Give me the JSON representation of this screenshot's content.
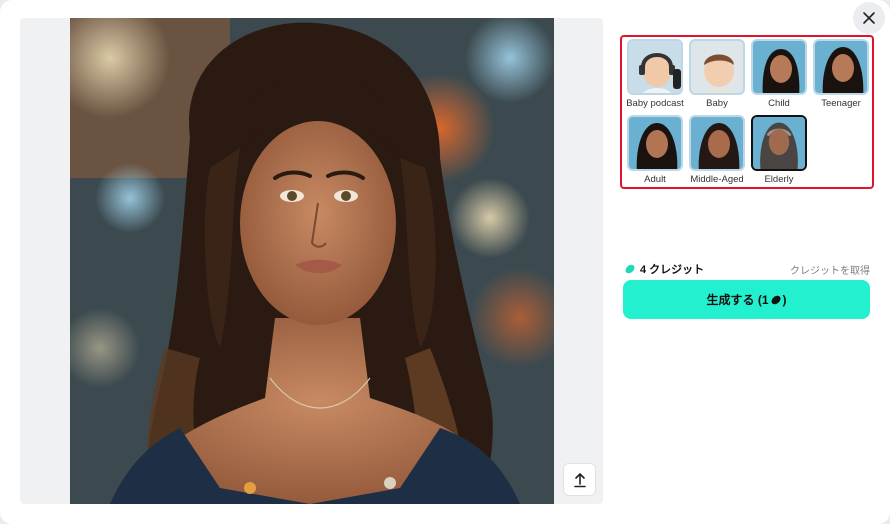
{
  "modal": {
    "close_icon": "close-icon",
    "upload_icon": "upload-icon"
  },
  "photo": {
    "description_icon": "portrait-photo"
  },
  "styles": [
    {
      "label": "Baby podcast",
      "selected": false
    },
    {
      "label": "Baby",
      "selected": false
    },
    {
      "label": "Child",
      "selected": false
    },
    {
      "label": "Teenager",
      "selected": false
    },
    {
      "label": "Adult",
      "selected": false
    },
    {
      "label": "Middle-Aged",
      "selected": false
    },
    {
      "label": "Elderly",
      "selected": true
    }
  ],
  "credits": {
    "amount_label": "4 クレジット",
    "get_label": "クレジットを取得",
    "icon": "credit-bean-icon"
  },
  "generate": {
    "label": "生成する (1",
    "label_suffix": ")",
    "icon": "credit-bean-icon"
  },
  "colors": {
    "accent": "#22f0cf",
    "highlight_border": "#e0142b",
    "credit_icon": "#1fd8b8"
  }
}
